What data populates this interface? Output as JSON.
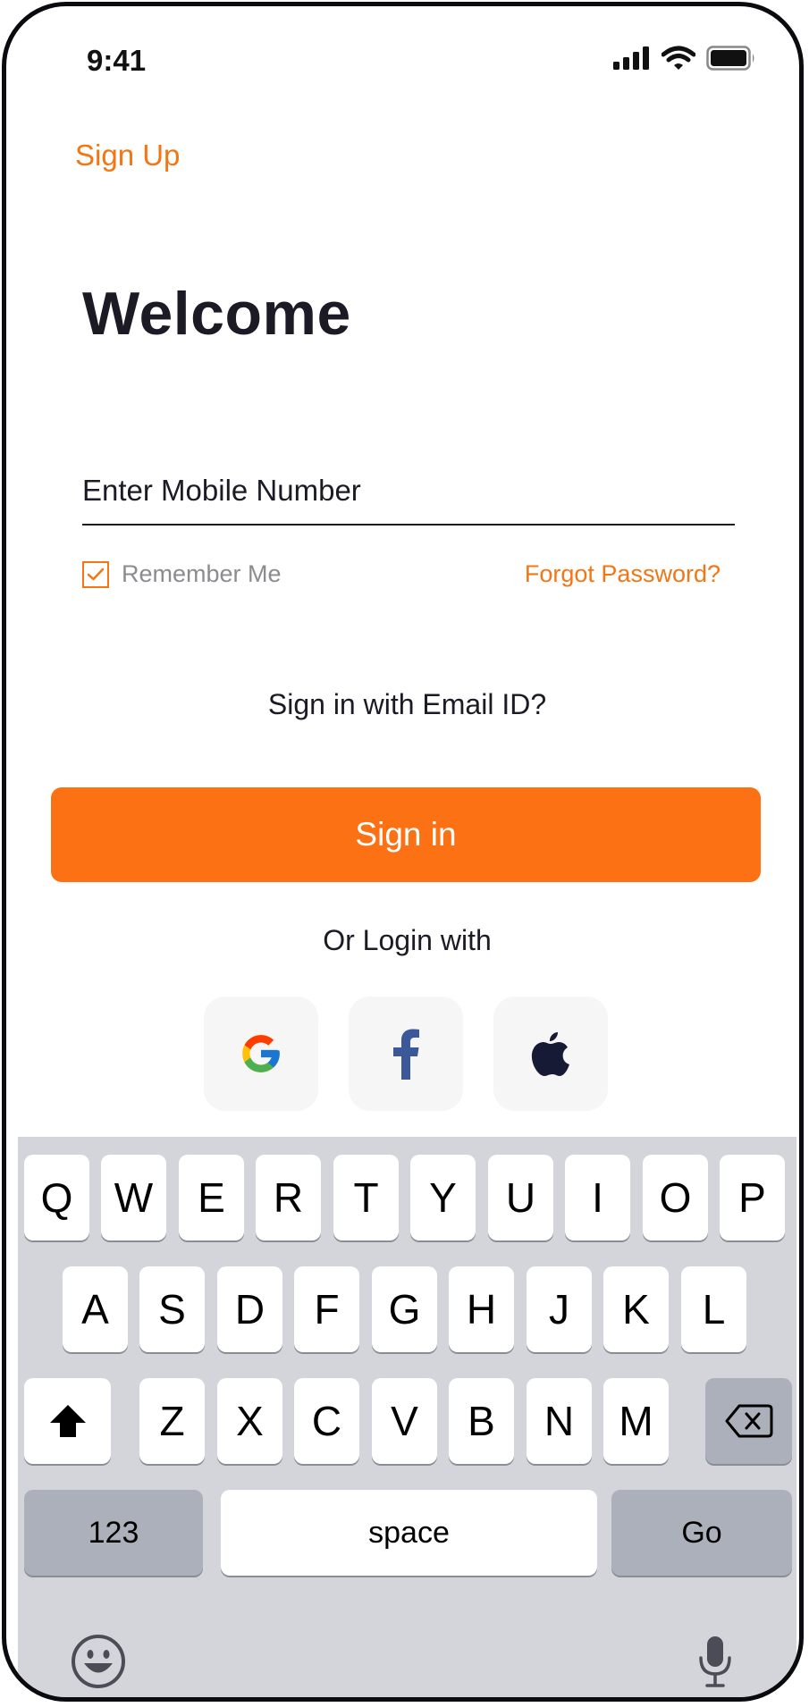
{
  "status": {
    "time": "9:41",
    "icons": [
      "cellular-signal-icon",
      "wifi-icon",
      "battery-icon"
    ]
  },
  "header": {
    "signup_label": "Sign Up"
  },
  "main": {
    "title": "Welcome",
    "mobile_placeholder": "Enter Mobile Number",
    "remember_label": "Remember Me",
    "remember_checked": true,
    "forgot_label": "Forgot Password?",
    "email_signin_label": "Sign in with Email ID?",
    "signin_label": "Sign in",
    "or_login_label": "Or Login with",
    "social": [
      "google-icon",
      "facebook-icon",
      "apple-icon"
    ]
  },
  "keyboard": {
    "row1": [
      "Q",
      "W",
      "E",
      "R",
      "T",
      "Y",
      "U",
      "I",
      "O",
      "P"
    ],
    "row2": [
      "A",
      "S",
      "D",
      "F",
      "G",
      "H",
      "J",
      "K",
      "L"
    ],
    "row3": [
      "Z",
      "X",
      "C",
      "V",
      "B",
      "N",
      "M"
    ],
    "numbers_label": "123",
    "space_label": "space",
    "go_label": "Go"
  },
  "colors": {
    "accent": "#fb7114",
    "text": "#1b1a25",
    "muted": "#8c8c90",
    "keyboard_bg": "#d3d5db"
  }
}
